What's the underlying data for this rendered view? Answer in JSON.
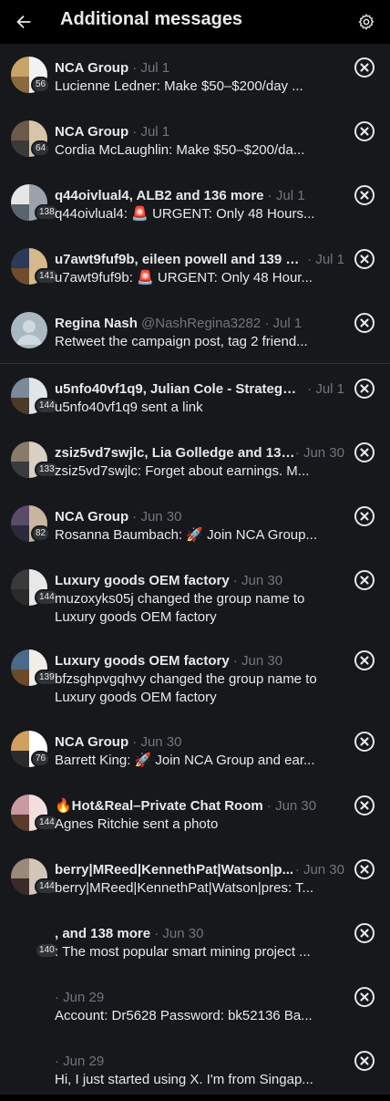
{
  "header": {
    "title": "Additional messages",
    "back_icon": "arrow-left-icon",
    "settings_icon": "gear-icon"
  },
  "colors": {
    "background": "#16181c",
    "header_bg": "#000000",
    "primary_text": "#e7e9ea",
    "secondary_text": "#71767b"
  },
  "conversations": [
    {
      "name": "NCA Group",
      "handle": "",
      "date": "Jul 1",
      "count": "56",
      "preview": "Lucienne Ledner: Make $50–$200/day ..."
    },
    {
      "name": "NCA Group",
      "handle": "",
      "date": "Jul 1",
      "count": "64",
      "preview": "Cordia McLaughlin: Make $50–$200/da..."
    },
    {
      "name": "q44oivlual4, ALB2 and 136 more",
      "handle": "",
      "date": "Jul 1",
      "count": "138",
      "preview": "q44oivlual4: 🚨 URGENT: Only 48 Hours..."
    },
    {
      "name": "u7awt9fuf9b, eileen powell and 139 m...",
      "handle": "",
      "date": "Jul 1",
      "count": "141",
      "preview": "u7awt9fuf9b: 🚨 URGENT: Only 48 Hour..."
    },
    {
      "name": "Regina Nash",
      "handle": "@NashRegina3282",
      "date": "Jul 1",
      "count": "",
      "preview": "Retweet the campaign post, tag 2 friend..."
    },
    {
      "name": "u5nfo40vf1q9, Julian Cole - Strategy ...",
      "handle": "",
      "date": "Jul 1",
      "count": "144",
      "preview": "u5nfo40vf1q9 sent a link"
    },
    {
      "name": "zsiz5vd7swjlc, Lia Golledge and 131 ...",
      "handle": "",
      "date": "Jun 30",
      "count": "133",
      "preview": "zsiz5vd7swjlc: Forget about earnings. M..."
    },
    {
      "name": "NCA Group",
      "handle": "",
      "date": "Jun 30",
      "count": "82",
      "preview": "Rosanna Baumbach: 🚀 Join NCA Group..."
    },
    {
      "name": "Luxury goods OEM factory",
      "handle": "",
      "date": "Jun 30",
      "count": "144",
      "preview": "muzoxyks05j changed the group name to Luxury goods OEM factory"
    },
    {
      "name": "Luxury goods OEM factory",
      "handle": "",
      "date": "Jun 30",
      "count": "139",
      "preview": "bfzsghpvgqhvy changed the group name to Luxury goods OEM factory"
    },
    {
      "name": "NCA Group",
      "handle": "",
      "date": "Jun 30",
      "count": "76",
      "preview": "Barrett King: 🚀 Join NCA Group and ear..."
    },
    {
      "name": "🔥Hot&Real–Private Chat Room",
      "handle": "",
      "date": "Jun 30",
      "count": "144",
      "preview": "Agnes Ritchie sent a photo"
    },
    {
      "name": "berry|MReed|KennethPat|Watson|p...",
      "handle": "",
      "date": "Jun 30",
      "count": "144",
      "preview": "berry|MReed|KennethPat|Watson|pres: T..."
    },
    {
      "name": ", and 138 more",
      "handle": "",
      "date": "Jun 30",
      "count": "140",
      "preview": ": The most popular smart mining project ..."
    },
    {
      "name": "",
      "handle": "",
      "date": "Jun 29",
      "count": "",
      "preview": "Account: Dr5628 Password: bk52136 Ba..."
    },
    {
      "name": "",
      "handle": "",
      "date": "Jun 29",
      "count": "",
      "preview": "Hi, I just started using X. I'm from Singap..."
    }
  ]
}
